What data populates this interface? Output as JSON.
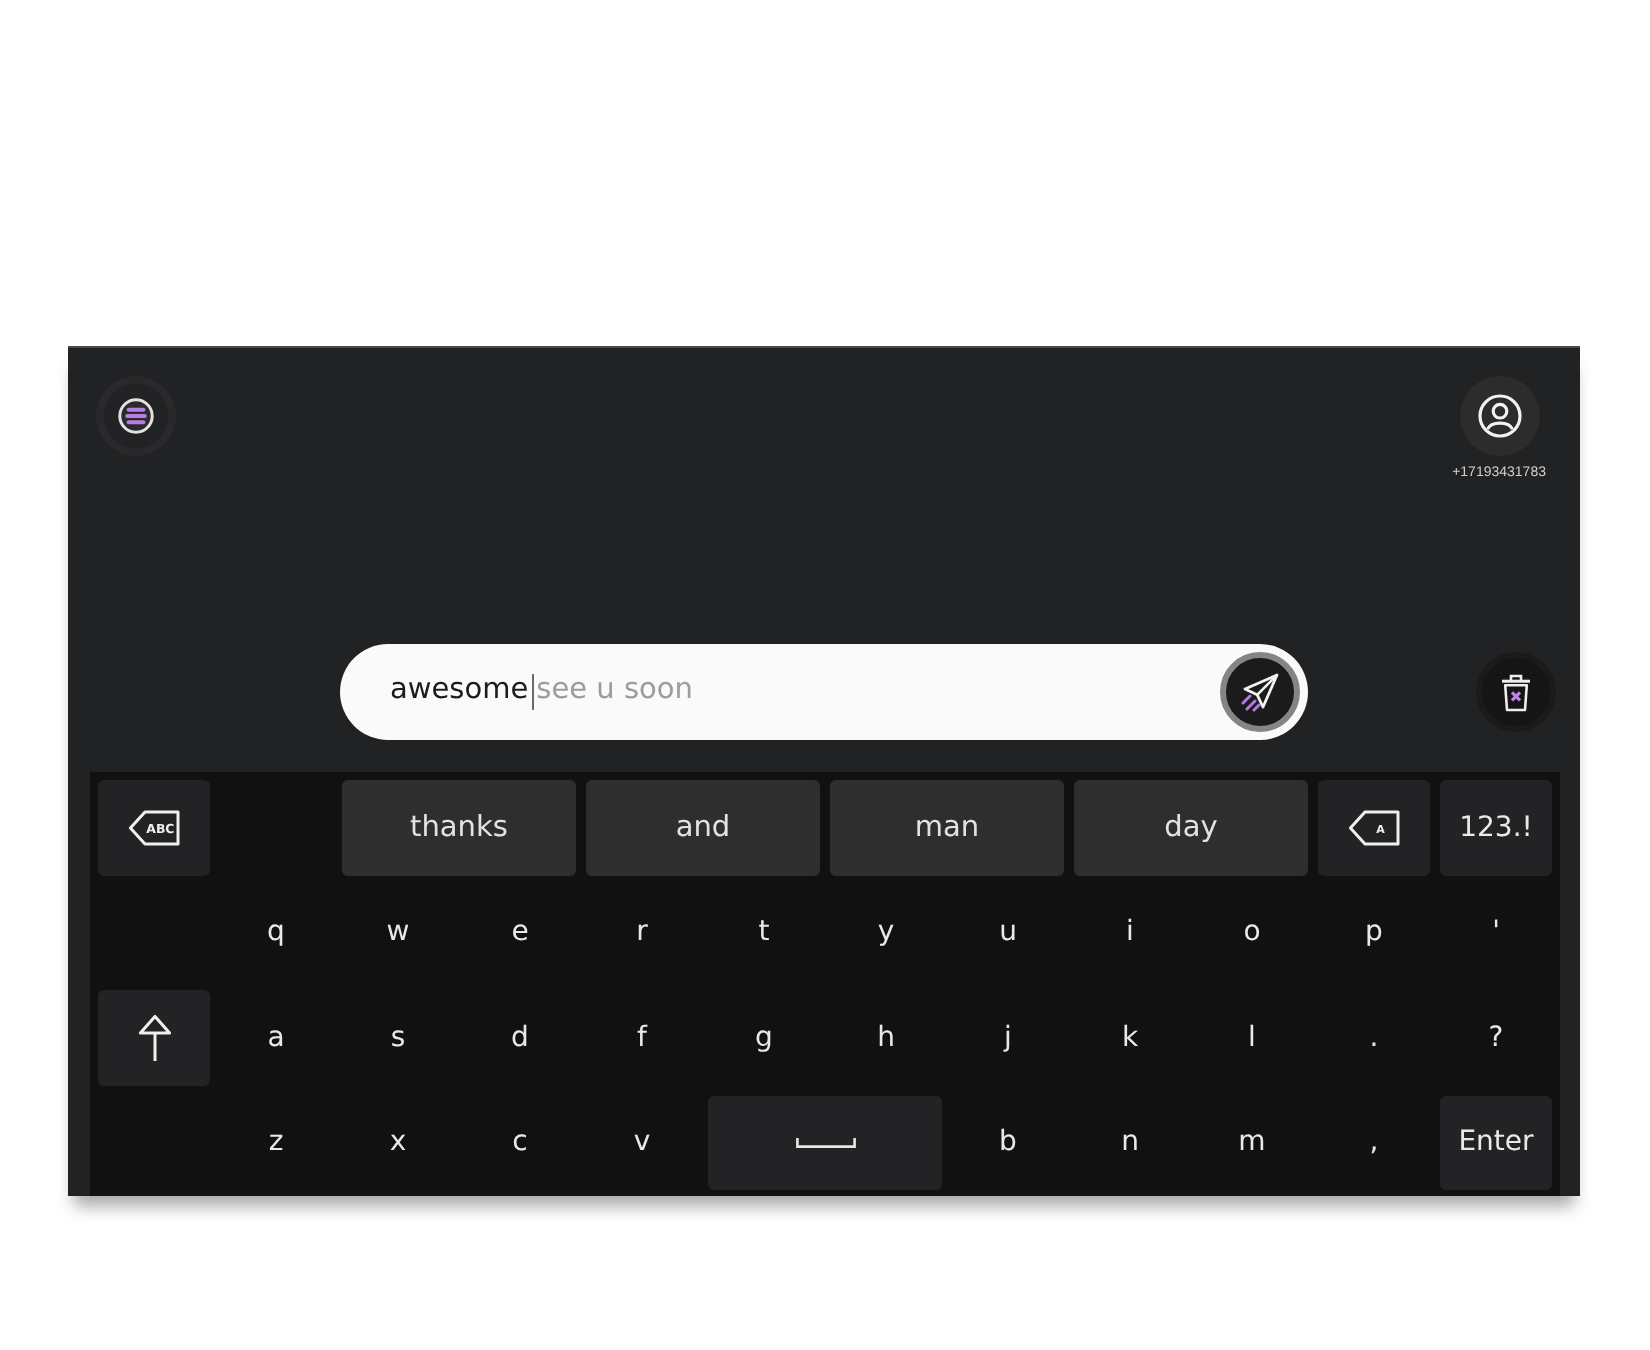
{
  "profile": {
    "phone_number": "+17193431783"
  },
  "message_input": {
    "value": "awesome",
    "completion": "see u soon"
  },
  "keyboard": {
    "suggestion_row": {
      "left_keys": [
        {
          "kind": "clear",
          "label": "ABC"
        }
      ],
      "suggestions": [
        "thanks",
        "and",
        "man",
        "day"
      ],
      "right_keys": [
        {
          "kind": "backspace",
          "label": "A"
        },
        {
          "kind": "symbols",
          "label": "123.!"
        }
      ]
    },
    "rows": [
      {
        "keys": [
          {
            "kind": "char",
            "label": "q"
          },
          {
            "kind": "char",
            "label": "w"
          },
          {
            "kind": "char",
            "label": "e"
          },
          {
            "kind": "char",
            "label": "r"
          },
          {
            "kind": "char",
            "label": "t"
          },
          {
            "kind": "char",
            "label": "y"
          },
          {
            "kind": "char",
            "label": "u"
          },
          {
            "kind": "char",
            "label": "i"
          },
          {
            "kind": "char",
            "label": "o"
          },
          {
            "kind": "char",
            "label": "p"
          },
          {
            "kind": "char",
            "label": "'"
          }
        ]
      },
      {
        "side_key": {
          "kind": "shift"
        },
        "keys": [
          {
            "kind": "char",
            "label": "a"
          },
          {
            "kind": "char",
            "label": "s"
          },
          {
            "kind": "char",
            "label": "d"
          },
          {
            "kind": "char",
            "label": "f"
          },
          {
            "kind": "char",
            "label": "g"
          },
          {
            "kind": "char",
            "label": "h"
          },
          {
            "kind": "char",
            "label": "j"
          },
          {
            "kind": "char",
            "label": "k"
          },
          {
            "kind": "char",
            "label": "l"
          },
          {
            "kind": "char",
            "label": "."
          },
          {
            "kind": "char",
            "label": "?"
          }
        ]
      },
      {
        "keys": [
          {
            "kind": "char",
            "label": "z"
          },
          {
            "kind": "char",
            "label": "x"
          },
          {
            "kind": "char",
            "label": "c"
          },
          {
            "kind": "char",
            "label": "v"
          },
          {
            "kind": "space"
          },
          {
            "kind": "char",
            "label": "b"
          },
          {
            "kind": "char",
            "label": "n"
          },
          {
            "kind": "char",
            "label": "m"
          },
          {
            "kind": "char",
            "label": ","
          },
          {
            "kind": "enter",
            "label": "Enter"
          }
        ]
      }
    ]
  }
}
